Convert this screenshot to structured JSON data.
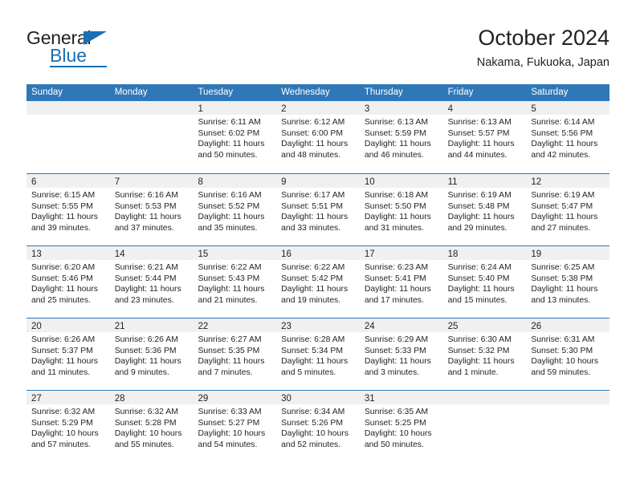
{
  "brand": {
    "name_top": "General",
    "name_bottom": "Blue",
    "accent_color": "#1a6fb5"
  },
  "header": {
    "title": "October 2024",
    "subtitle": "Nakama, Fukuoka, Japan"
  },
  "theme": {
    "header_bar_color": "#2e78b8",
    "daynum_band_color": "#f0f0f0",
    "text_color": "#231f20"
  },
  "weekday_headers": [
    "Sunday",
    "Monday",
    "Tuesday",
    "Wednesday",
    "Thursday",
    "Friday",
    "Saturday"
  ],
  "weeks": [
    [
      {
        "day": "",
        "sunrise": "",
        "sunset": "",
        "daylight1": "",
        "daylight2": "",
        "empty": true
      },
      {
        "day": "",
        "sunrise": "",
        "sunset": "",
        "daylight1": "",
        "daylight2": "",
        "empty": true
      },
      {
        "day": "1",
        "sunrise": "Sunrise: 6:11 AM",
        "sunset": "Sunset: 6:02 PM",
        "daylight1": "Daylight: 11 hours",
        "daylight2": "and 50 minutes."
      },
      {
        "day": "2",
        "sunrise": "Sunrise: 6:12 AM",
        "sunset": "Sunset: 6:00 PM",
        "daylight1": "Daylight: 11 hours",
        "daylight2": "and 48 minutes."
      },
      {
        "day": "3",
        "sunrise": "Sunrise: 6:13 AM",
        "sunset": "Sunset: 5:59 PM",
        "daylight1": "Daylight: 11 hours",
        "daylight2": "and 46 minutes."
      },
      {
        "day": "4",
        "sunrise": "Sunrise: 6:13 AM",
        "sunset": "Sunset: 5:57 PM",
        "daylight1": "Daylight: 11 hours",
        "daylight2": "and 44 minutes."
      },
      {
        "day": "5",
        "sunrise": "Sunrise: 6:14 AM",
        "sunset": "Sunset: 5:56 PM",
        "daylight1": "Daylight: 11 hours",
        "daylight2": "and 42 minutes."
      }
    ],
    [
      {
        "day": "6",
        "sunrise": "Sunrise: 6:15 AM",
        "sunset": "Sunset: 5:55 PM",
        "daylight1": "Daylight: 11 hours",
        "daylight2": "and 39 minutes."
      },
      {
        "day": "7",
        "sunrise": "Sunrise: 6:16 AM",
        "sunset": "Sunset: 5:53 PM",
        "daylight1": "Daylight: 11 hours",
        "daylight2": "and 37 minutes."
      },
      {
        "day": "8",
        "sunrise": "Sunrise: 6:16 AM",
        "sunset": "Sunset: 5:52 PM",
        "daylight1": "Daylight: 11 hours",
        "daylight2": "and 35 minutes."
      },
      {
        "day": "9",
        "sunrise": "Sunrise: 6:17 AM",
        "sunset": "Sunset: 5:51 PM",
        "daylight1": "Daylight: 11 hours",
        "daylight2": "and 33 minutes."
      },
      {
        "day": "10",
        "sunrise": "Sunrise: 6:18 AM",
        "sunset": "Sunset: 5:50 PM",
        "daylight1": "Daylight: 11 hours",
        "daylight2": "and 31 minutes."
      },
      {
        "day": "11",
        "sunrise": "Sunrise: 6:19 AM",
        "sunset": "Sunset: 5:48 PM",
        "daylight1": "Daylight: 11 hours",
        "daylight2": "and 29 minutes."
      },
      {
        "day": "12",
        "sunrise": "Sunrise: 6:19 AM",
        "sunset": "Sunset: 5:47 PM",
        "daylight1": "Daylight: 11 hours",
        "daylight2": "and 27 minutes."
      }
    ],
    [
      {
        "day": "13",
        "sunrise": "Sunrise: 6:20 AM",
        "sunset": "Sunset: 5:46 PM",
        "daylight1": "Daylight: 11 hours",
        "daylight2": "and 25 minutes."
      },
      {
        "day": "14",
        "sunrise": "Sunrise: 6:21 AM",
        "sunset": "Sunset: 5:44 PM",
        "daylight1": "Daylight: 11 hours",
        "daylight2": "and 23 minutes."
      },
      {
        "day": "15",
        "sunrise": "Sunrise: 6:22 AM",
        "sunset": "Sunset: 5:43 PM",
        "daylight1": "Daylight: 11 hours",
        "daylight2": "and 21 minutes."
      },
      {
        "day": "16",
        "sunrise": "Sunrise: 6:22 AM",
        "sunset": "Sunset: 5:42 PM",
        "daylight1": "Daylight: 11 hours",
        "daylight2": "and 19 minutes."
      },
      {
        "day": "17",
        "sunrise": "Sunrise: 6:23 AM",
        "sunset": "Sunset: 5:41 PM",
        "daylight1": "Daylight: 11 hours",
        "daylight2": "and 17 minutes."
      },
      {
        "day": "18",
        "sunrise": "Sunrise: 6:24 AM",
        "sunset": "Sunset: 5:40 PM",
        "daylight1": "Daylight: 11 hours",
        "daylight2": "and 15 minutes."
      },
      {
        "day": "19",
        "sunrise": "Sunrise: 6:25 AM",
        "sunset": "Sunset: 5:38 PM",
        "daylight1": "Daylight: 11 hours",
        "daylight2": "and 13 minutes."
      }
    ],
    [
      {
        "day": "20",
        "sunrise": "Sunrise: 6:26 AM",
        "sunset": "Sunset: 5:37 PM",
        "daylight1": "Daylight: 11 hours",
        "daylight2": "and 11 minutes."
      },
      {
        "day": "21",
        "sunrise": "Sunrise: 6:26 AM",
        "sunset": "Sunset: 5:36 PM",
        "daylight1": "Daylight: 11 hours",
        "daylight2": "and 9 minutes."
      },
      {
        "day": "22",
        "sunrise": "Sunrise: 6:27 AM",
        "sunset": "Sunset: 5:35 PM",
        "daylight1": "Daylight: 11 hours",
        "daylight2": "and 7 minutes."
      },
      {
        "day": "23",
        "sunrise": "Sunrise: 6:28 AM",
        "sunset": "Sunset: 5:34 PM",
        "daylight1": "Daylight: 11 hours",
        "daylight2": "and 5 minutes."
      },
      {
        "day": "24",
        "sunrise": "Sunrise: 6:29 AM",
        "sunset": "Sunset: 5:33 PM",
        "daylight1": "Daylight: 11 hours",
        "daylight2": "and 3 minutes."
      },
      {
        "day": "25",
        "sunrise": "Sunrise: 6:30 AM",
        "sunset": "Sunset: 5:32 PM",
        "daylight1": "Daylight: 11 hours",
        "daylight2": "and 1 minute."
      },
      {
        "day": "26",
        "sunrise": "Sunrise: 6:31 AM",
        "sunset": "Sunset: 5:30 PM",
        "daylight1": "Daylight: 10 hours",
        "daylight2": "and 59 minutes."
      }
    ],
    [
      {
        "day": "27",
        "sunrise": "Sunrise: 6:32 AM",
        "sunset": "Sunset: 5:29 PM",
        "daylight1": "Daylight: 10 hours",
        "daylight2": "and 57 minutes."
      },
      {
        "day": "28",
        "sunrise": "Sunrise: 6:32 AM",
        "sunset": "Sunset: 5:28 PM",
        "daylight1": "Daylight: 10 hours",
        "daylight2": "and 55 minutes."
      },
      {
        "day": "29",
        "sunrise": "Sunrise: 6:33 AM",
        "sunset": "Sunset: 5:27 PM",
        "daylight1": "Daylight: 10 hours",
        "daylight2": "and 54 minutes."
      },
      {
        "day": "30",
        "sunrise": "Sunrise: 6:34 AM",
        "sunset": "Sunset: 5:26 PM",
        "daylight1": "Daylight: 10 hours",
        "daylight2": "and 52 minutes."
      },
      {
        "day": "31",
        "sunrise": "Sunrise: 6:35 AM",
        "sunset": "Sunset: 5:25 PM",
        "daylight1": "Daylight: 10 hours",
        "daylight2": "and 50 minutes."
      },
      {
        "day": "",
        "sunrise": "",
        "sunset": "",
        "daylight1": "",
        "daylight2": "",
        "empty": true
      },
      {
        "day": "",
        "sunrise": "",
        "sunset": "",
        "daylight1": "",
        "daylight2": "",
        "empty": true
      }
    ]
  ]
}
